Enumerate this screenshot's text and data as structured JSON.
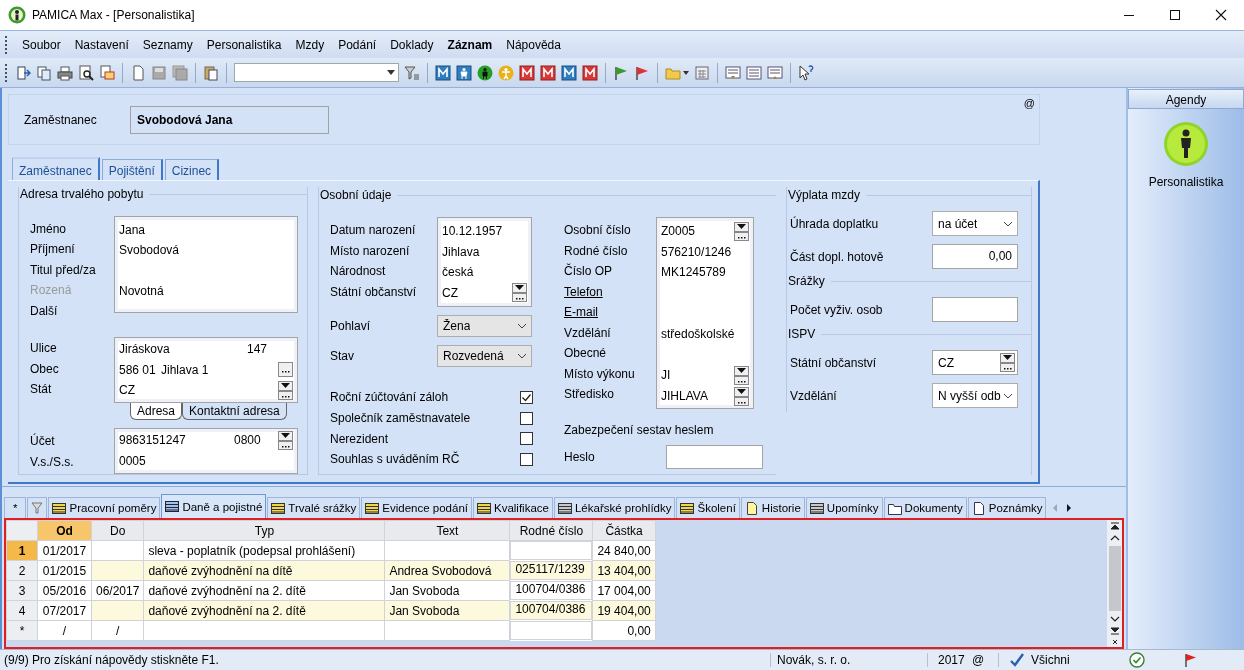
{
  "window": {
    "title": "PAMICA Max - [Personalistika]"
  },
  "menu": [
    {
      "label": "Soubor",
      "bold": false
    },
    {
      "label": "Nastavení",
      "bold": false
    },
    {
      "label": "Seznamy",
      "bold": false
    },
    {
      "label": "Personalistika",
      "bold": false
    },
    {
      "label": "Mzdy",
      "bold": false
    },
    {
      "label": "Podání",
      "bold": false
    },
    {
      "label": "Doklady",
      "bold": false
    },
    {
      "label": "Záznam",
      "bold": true
    },
    {
      "label": "Nápověda",
      "bold": false
    }
  ],
  "employee": {
    "label": "Zaměstnanec",
    "value": "Svobodová Jana",
    "mail_mark": "@"
  },
  "tabs": [
    {
      "label": "Zaměstnanec",
      "selected": true
    },
    {
      "label": "Pojištění",
      "selected": false
    },
    {
      "label": "Cizinec",
      "selected": false
    }
  ],
  "address": {
    "title": "Adresa trvalého pobytu",
    "name_rows": [
      {
        "label": "Jméno",
        "value": "Jana",
        "disabled": false
      },
      {
        "label": "Příjmení",
        "value": "Svobodová",
        "disabled": false
      },
      {
        "label": "Titul před/za",
        "disabled": false
      },
      {
        "label": "Rozená",
        "value": "Novotná",
        "disabled": true
      },
      {
        "label": "Další",
        "disabled": false
      }
    ],
    "street_rows": [
      {
        "label": "Ulice",
        "value": "Jiráskova",
        "value2": "147",
        "kind": "plain"
      },
      {
        "label": "Obec",
        "value": "586 01",
        "value2": "Jihlava 1",
        "kind": "dots"
      },
      {
        "label": "Stát",
        "value": "CZ",
        "kind": "picker"
      }
    ],
    "address_tabs": [
      {
        "label": "Adresa",
        "selected": true
      },
      {
        "label": "Kontaktní adresa",
        "selected": false
      }
    ],
    "bank_rows": [
      {
        "label": "Účet",
        "value": "9863151247",
        "value2": "0800",
        "kind": "picker"
      },
      {
        "label": "V.s./S.s.",
        "value": "0005",
        "kind": "plain"
      }
    ]
  },
  "personal": {
    "title": "Osobní údaje",
    "rows": [
      {
        "label": "Datum narození",
        "value": "10.12.1957",
        "kind": "plain"
      },
      {
        "label": "Místo narození",
        "value": "Jihlava",
        "kind": "plain"
      },
      {
        "label": "Národnost",
        "value": "česká",
        "kind": "plain"
      },
      {
        "label": "Státní občanství",
        "value": "CZ",
        "kind": "picker"
      }
    ],
    "selects": [
      {
        "label": "Pohlaví",
        "value": "Žena"
      },
      {
        "label": "Stav",
        "value": "Rozvedená"
      }
    ],
    "checks": [
      {
        "label": "Roční zúčtování záloh",
        "checked": true
      },
      {
        "label": "Společník zaměstnavatele",
        "checked": false
      },
      {
        "label": "Nerezident",
        "checked": false
      },
      {
        "label": "Souhlas s uváděním RČ",
        "checked": false
      }
    ],
    "id_rows": [
      {
        "label": "Osobní číslo",
        "value": "Z0005",
        "kind": "picker",
        "link": false
      },
      {
        "label": "Rodné číslo",
        "value": "576210/1246",
        "kind": "plain",
        "link": false
      },
      {
        "label": "Číslo OP",
        "value": "MK1245789",
        "kind": "plain",
        "link": false
      },
      {
        "label": "Telefon",
        "kind": "plain",
        "link": true
      },
      {
        "label": "E-mail",
        "kind": "plain",
        "link": true
      },
      {
        "label": "Vzdělání",
        "value": "středoškolské",
        "kind": "plain",
        "link": false
      },
      {
        "label": "Obecné",
        "kind": "plain",
        "link": false
      },
      {
        "label": "Místo výkonu",
        "value": "JI",
        "kind": "picker",
        "link": false
      },
      {
        "label": "Středisko",
        "value": "JIHLAVA",
        "kind": "picker",
        "link": false
      }
    ],
    "security": {
      "title": "Zabezpečení sestav heslem",
      "label": "Heslo"
    }
  },
  "payout": {
    "title": "Výplata mzdy",
    "fields": [
      {
        "kind": "select",
        "label": "Úhrada doplatku",
        "value": "na účet"
      },
      {
        "kind": "number",
        "label": "Část dopl. hotově",
        "value": "0,00"
      }
    ]
  },
  "deductions": {
    "title": "Srážky",
    "fields": [
      {
        "kind": "number",
        "label": "Počet vyživ. osob"
      }
    ]
  },
  "ispv": {
    "title": "ISPV",
    "fields": [
      {
        "kind": "picker",
        "label": "Státní občanství",
        "value": "CZ"
      },
      {
        "kind": "select",
        "label": "Vzdělání",
        "value": "N vyšší odb"
      }
    ]
  },
  "agendas": {
    "title": "Agendy",
    "items": [
      {
        "label": "Personalistika"
      }
    ]
  },
  "bottom_tabs": {
    "new_mark": "*",
    "items": [
      {
        "label": "Pracovní poměry",
        "kind": "striped",
        "selected": false
      },
      {
        "label": "Daně a pojistné",
        "kind": "blue",
        "selected": true
      },
      {
        "label": "Trvalé srážky",
        "kind": "striped",
        "selected": false
      },
      {
        "label": "Evidence podání",
        "kind": "striped",
        "selected": false
      },
      {
        "label": "Kvalifikace",
        "kind": "striped",
        "selected": false
      },
      {
        "label": "Lékařské prohlídky",
        "kind": "grey",
        "selected": false
      },
      {
        "label": "Školení",
        "kind": "striped",
        "selected": false
      },
      {
        "label": "Historie",
        "kind": "note",
        "selected": false
      },
      {
        "label": "Upomínky",
        "kind": "grey",
        "selected": false
      },
      {
        "label": "Dokumenty",
        "kind": "folder",
        "selected": false
      },
      {
        "label": "Poznámky",
        "kind": "page",
        "selected": false
      }
    ]
  },
  "table": {
    "columns": [
      {
        "label": "Od",
        "selected": true
      },
      {
        "label": "Do",
        "selected": false
      },
      {
        "label": "Typ",
        "selected": false
      },
      {
        "label": "Text",
        "selected": false
      },
      {
        "label": "Rodné číslo",
        "selected": false
      },
      {
        "label": "Částka",
        "selected": false
      }
    ],
    "rows": [
      {
        "header": "1",
        "selected": true,
        "cells": [
          "01/2017",
          null,
          "sleva - poplatník (podepsal prohlášení)",
          null,
          null,
          "24 840,00"
        ]
      },
      {
        "header": "2",
        "selected": false,
        "cells": [
          "01/2015",
          null,
          "daňové zvýhodnění na dítě",
          "Andrea Svobodová",
          "025117/1239",
          "13 404,00"
        ]
      },
      {
        "header": "3",
        "selected": false,
        "cells": [
          "05/2016",
          "06/2017",
          "daňové zvýhodnění na 2. dítě",
          "Jan Svoboda",
          "100704/0386",
          "17 004,00"
        ]
      },
      {
        "header": "4",
        "selected": false,
        "cells": [
          "07/2017",
          null,
          "daňové zvýhodnění na 2. dítě",
          "Jan Svoboda",
          "100704/0386",
          "19 404,00"
        ]
      },
      {
        "header": "*",
        "selected": false,
        "cells": [
          "/",
          "/",
          null,
          null,
          null,
          "0,00"
        ]
      }
    ]
  },
  "status_bar": {
    "message": "(9/9) Pro získání nápovědy stiskněte F1.",
    "company": "Novák, s. r. o.",
    "year": "2017",
    "mail_mark": "@",
    "user_filter": "Všichni"
  }
}
